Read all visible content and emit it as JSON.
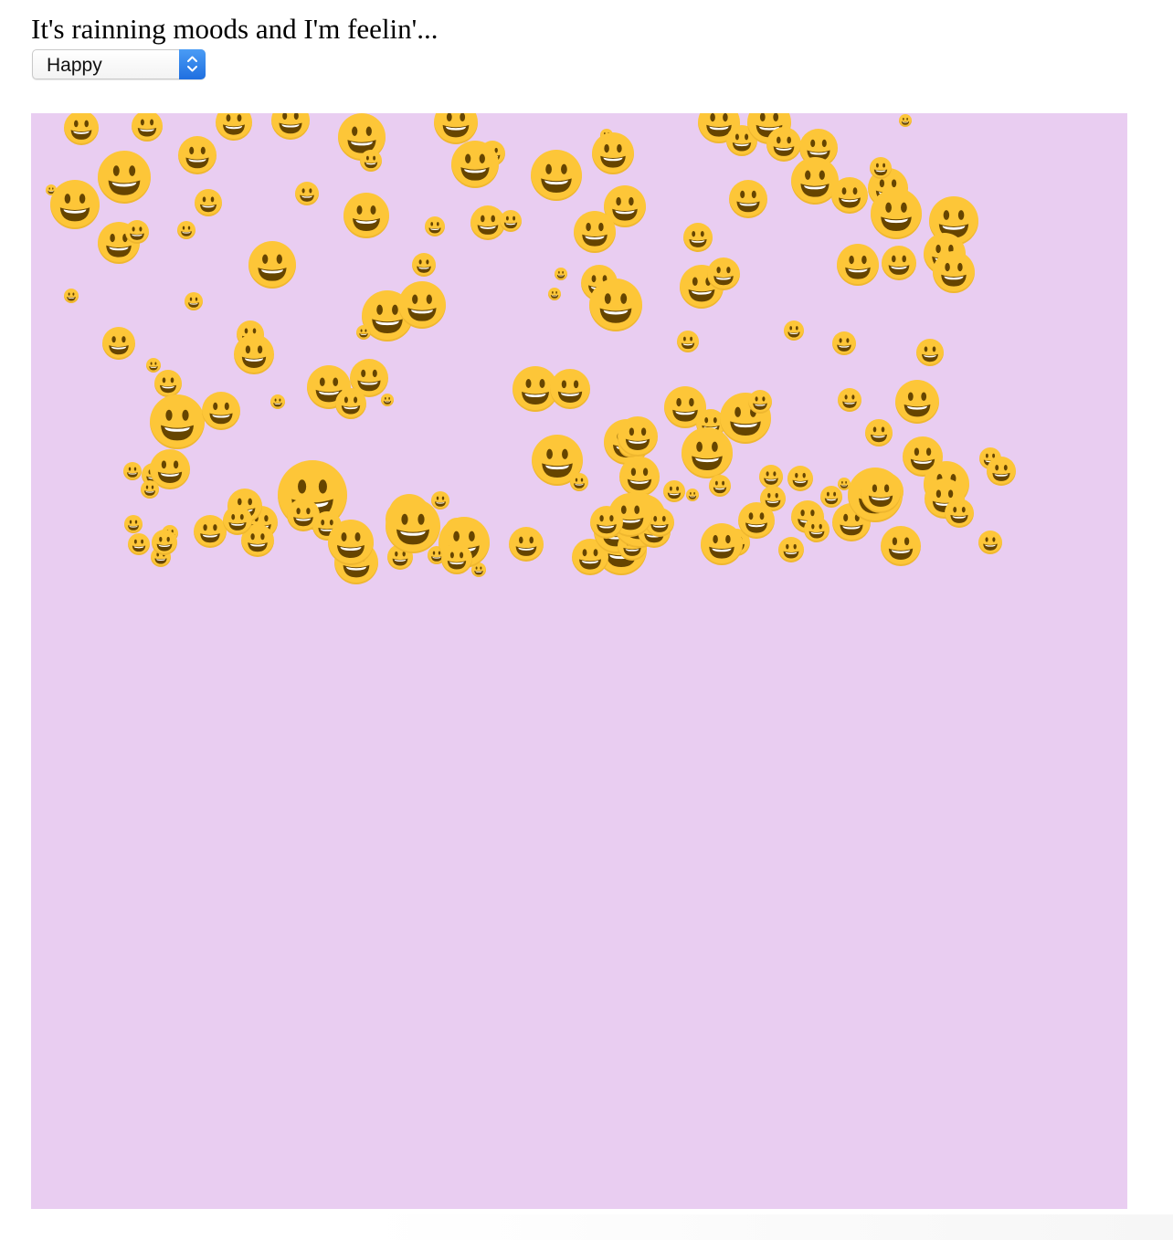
{
  "page": {
    "prompt_text": "It's rainning moods and I'm feelin'...",
    "background_color": "#ffffff"
  },
  "mood_select": {
    "selected_value": "Happy",
    "icon": "chevron-up-down-icon",
    "accent_color": "#2a7ee8"
  },
  "rain_canvas": {
    "background_color": "#e9cdf1",
    "emoji_icon": "grinning-face-icon",
    "emoji_color": "#fdc638"
  }
}
